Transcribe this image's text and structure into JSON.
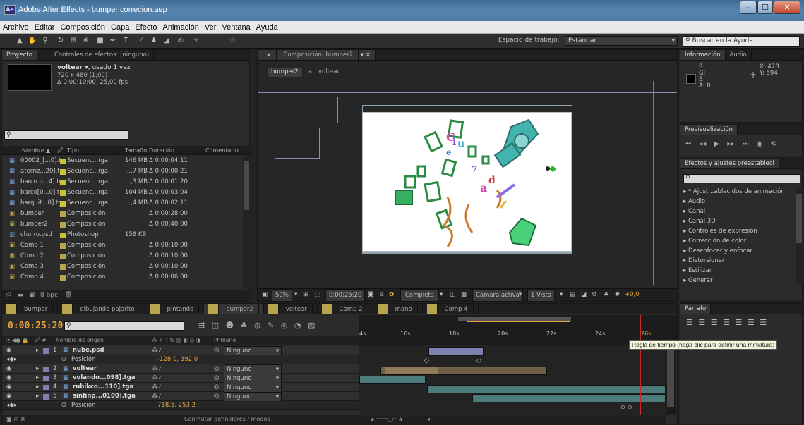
{
  "window": {
    "title": "Adobe After Effects - bumper correcion.aep",
    "app_icon": "Ae",
    "min": "–",
    "max": "☐",
    "close": "✕"
  },
  "menu": [
    "Archivo",
    "Editar",
    "Composición",
    "Capa",
    "Efecto",
    "Animación",
    "Ver",
    "Ventana",
    "Ayuda"
  ],
  "toolbar": {
    "workspace_label": "Espacio de trabajo:",
    "workspace_value": "Estándar",
    "help_placeholder": "Buscar en la Ayuda"
  },
  "project": {
    "tab": "Proyecto",
    "tab2": "Controles de efectos: (ninguno)",
    "item_name": "voltear",
    "item_used": ", usado 1 vez",
    "item_size": "720 x 480 (1,00)",
    "item_duration": "Δ 0:00:10:00, 25,00 fps",
    "columns": [
      "Nombre",
      "Tipo",
      "Tamaño",
      "Duración",
      "Comentario"
    ],
    "rows": [
      {
        "name": "00002_[...0].tga",
        "type": "Secuenc...rga",
        "size": "146 MB",
        "dur": "Δ 0:00:04:11",
        "color": "#c9c33a"
      },
      {
        "name": "aterriz...20].tga",
        "type": "Secuenc...rga",
        "size": "...,7 MB",
        "dur": "Δ 0:00:00:21",
        "color": "#c9c33a"
      },
      {
        "name": "barco p...4].tga",
        "type": "Secuenc...rga",
        "size": "...,3 MB",
        "dur": "Δ 0:00:01:20",
        "color": "#c9c33a"
      },
      {
        "name": "barco[0...0].tga",
        "type": "Secuenc...rga",
        "size": "104 MB",
        "dur": "Δ 0:00:03:04",
        "color": "#c9c33a"
      },
      {
        "name": "barquit...0].tga",
        "type": "Secuenc...rga",
        "size": "...,4 MB",
        "dur": "Δ 0:00:02:11",
        "color": "#c9c33a"
      },
      {
        "name": "bumper",
        "type": "Composición",
        "size": "",
        "dur": "Δ 0:00:28:00",
        "color": "#b7a44e"
      },
      {
        "name": "bumper2",
        "type": "Composición",
        "size": "",
        "dur": "Δ 0:00:40:00",
        "color": "#b7a44e"
      },
      {
        "name": "chorro.psd",
        "type": "Photoshop",
        "size": "158 KB",
        "dur": "",
        "color": "#c9c33a"
      },
      {
        "name": "Comp 1",
        "type": "Composición",
        "size": "",
        "dur": "Δ 0:00:10:00",
        "color": "#b7a44e"
      },
      {
        "name": "Comp 2",
        "type": "Composición",
        "size": "",
        "dur": "Δ 0:00:10:00",
        "color": "#b7a44e"
      },
      {
        "name": "Comp 3",
        "type": "Composición",
        "size": "",
        "dur": "Δ 0:00:10:00",
        "color": "#b7a44e"
      },
      {
        "name": "Comp 4",
        "type": "Composición",
        "size": "",
        "dur": "Δ 0:00:06:00",
        "color": "#b7a44e"
      }
    ],
    "footer_bpc": "8 bpc"
  },
  "composition": {
    "tab": "Composición: bumper2",
    "breadcrumb_1": "bumper2",
    "breadcrumb_2": "voltear",
    "zoom": "50%",
    "timecode": "0:00:25:20",
    "resolution": "Completa",
    "camera": "Cámara activa",
    "views": "1 Vista",
    "exposure": "+0,0"
  },
  "info": {
    "tab": "Información",
    "tab2": "Audio",
    "r": "R:",
    "g": "G:",
    "b": "B:",
    "a": "A: 0",
    "x": "X: 478",
    "y": "Y: 594"
  },
  "preview": {
    "tab": "Previsualización"
  },
  "effects": {
    "tab": "Efectos y ajustes preestableci",
    "items": [
      "* Ajust...ablecidos de animación",
      "Audio",
      "Canal",
      "Canal 3D",
      "Controles de expresión",
      "Corrección de color",
      "Desenfocar y enfocar",
      "Distorsionar",
      "Estilizar",
      "Generar"
    ]
  },
  "paragraph": {
    "tab": "Párrafo"
  },
  "timeline": {
    "tabs": [
      "bumper",
      "dibujando pajarito",
      "pintando",
      "bumper2",
      "voltear",
      "Comp 2",
      "mano",
      "Comp 4"
    ],
    "active_tab_index": 3,
    "timecode": "0:00:25:20",
    "ruler": [
      "4s",
      "16s",
      "18s",
      "20s",
      "22s",
      "24s",
      "26s"
    ],
    "col_name": "Nombre de origen",
    "col_parent": "Primario",
    "layers": [
      {
        "num": "1",
        "name": "nube.psd",
        "parent": "Ninguno"
      },
      {
        "prop": "Posición",
        "value": "-128,0, 392,0"
      },
      {
        "num": "2",
        "name": "voltear",
        "parent": "Ninguno"
      },
      {
        "num": "3",
        "name": "volando...098].tga",
        "parent": "Ninguno"
      },
      {
        "num": "4",
        "name": "rubikco...110].tga",
        "parent": "Ninguno"
      },
      {
        "num": "5",
        "name": "sinfinp...0100].tga",
        "parent": "Ninguno"
      },
      {
        "prop": "Posición",
        "value": "718,5, 253,2"
      }
    ],
    "footer": "Conmutar definidores / modos",
    "tooltip": "Regla de tiempo (haga clic para definir una miniatura)"
  },
  "colors": {
    "accent": "#e8a33a",
    "timecode": "#e8a33a",
    "playhead": "#c42a2a"
  }
}
